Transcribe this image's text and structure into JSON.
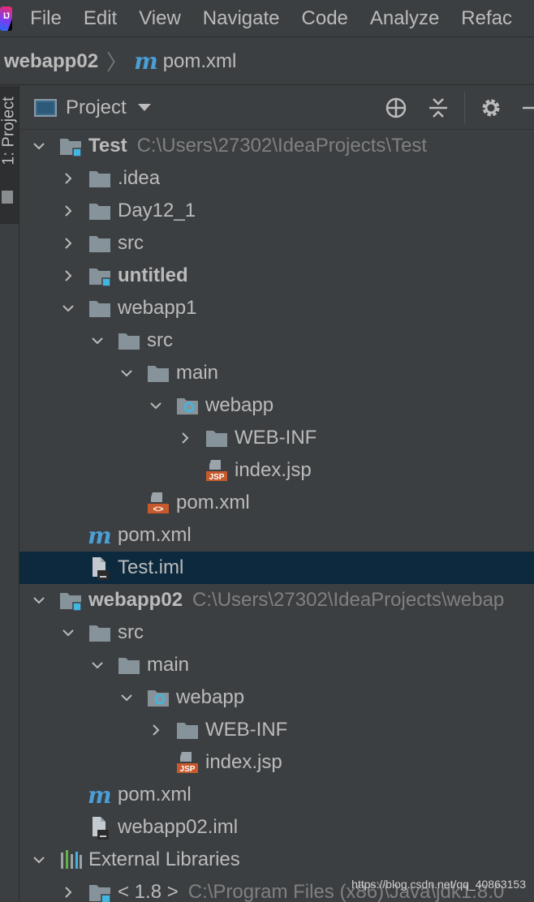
{
  "menu": {
    "logo": "IJ",
    "items": [
      "File",
      "Edit",
      "View",
      "Navigate",
      "Code",
      "Analyze",
      "Refac"
    ]
  },
  "breadcrumb": {
    "project": "webapp02",
    "separator": "〉",
    "file_icon": "m",
    "file": "pom.xml"
  },
  "left_strip": {
    "tab_label": "1: Project"
  },
  "panel": {
    "title": "Project",
    "icons": [
      "locate-icon",
      "collapse-icon",
      "gear-icon",
      "hide-icon"
    ]
  },
  "tree": [
    {
      "label": "Test",
      "path": "C:\\Users\\27302\\IdeaProjects\\Test",
      "icon": "module-folder",
      "bold": true,
      "expanded": true
    },
    {
      "label": ".idea",
      "icon": "folder",
      "expanded": false
    },
    {
      "label": "Day12_1",
      "icon": "folder",
      "expanded": false
    },
    {
      "label": "src",
      "icon": "folder",
      "expanded": false
    },
    {
      "label": "untitled",
      "icon": "module-folder",
      "bold": true,
      "expanded": false
    },
    {
      "label": "webapp1",
      "icon": "folder",
      "expanded": true
    },
    {
      "label": "src",
      "icon": "folder",
      "expanded": true
    },
    {
      "label": "main",
      "icon": "folder",
      "expanded": true
    },
    {
      "label": "webapp",
      "icon": "web-folder",
      "expanded": true
    },
    {
      "label": "WEB-INF",
      "icon": "folder",
      "expanded": false
    },
    {
      "label": "index.jsp",
      "icon": "jsp-file",
      "leaf": true
    },
    {
      "label": "pom.xml",
      "icon": "xml-file",
      "leaf": true
    },
    {
      "label": "pom.xml",
      "icon": "maven-file",
      "leaf": true
    },
    {
      "label": "Test.iml",
      "icon": "iml-file",
      "leaf": true,
      "selected": true
    },
    {
      "label": "webapp02",
      "path": "C:\\Users\\27302\\IdeaProjects\\webap",
      "icon": "module-folder",
      "bold": true,
      "expanded": true
    },
    {
      "label": "src",
      "icon": "folder",
      "expanded": true
    },
    {
      "label": "main",
      "icon": "folder",
      "expanded": true
    },
    {
      "label": "webapp",
      "icon": "web-folder",
      "expanded": true
    },
    {
      "label": "WEB-INF",
      "icon": "folder",
      "expanded": false
    },
    {
      "label": "index.jsp",
      "icon": "jsp-file",
      "leaf": true
    },
    {
      "label": "pom.xml",
      "icon": "maven-file",
      "leaf": true
    },
    {
      "label": "webapp02.iml",
      "icon": "iml-file",
      "leaf": true
    },
    {
      "label": "External Libraries",
      "icon": "libraries",
      "expanded": true
    },
    {
      "label": "< 1.8 >",
      "path": "C:\\Program Files (x86)\\Java\\jdk1.8.0",
      "icon": "jdk-folder",
      "expanded": false
    }
  ],
  "watermark": "https://blog.csdn.net/qq_40863153"
}
